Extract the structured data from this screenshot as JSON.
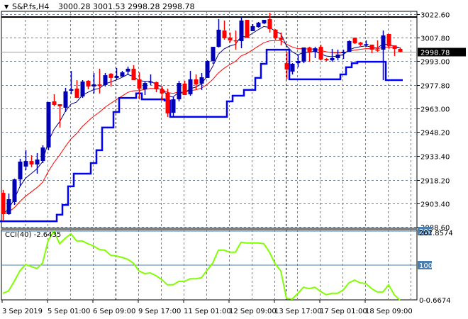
{
  "chart_data": {
    "type": "candlestick",
    "symbol_header": "S&P.fs,H4",
    "ohlc_header": "3000.28 3001.53 2998.28 2998.78",
    "current_price": 2998.78,
    "current_price_label": "2998.78",
    "resistance_level": 3020.8,
    "ylim": [
      2888.6,
      3024.4
    ],
    "price_ticks": [
      "3022.60",
      "3007.80",
      "2993.00",
      "2977.80",
      "2963.00",
      "2948.20",
      "2933.40",
      "2918.20",
      "2903.40",
      "2888.60"
    ],
    "price_tick_values": [
      3022.6,
      3007.8,
      2993.0,
      2977.8,
      2963.0,
      2948.2,
      2933.4,
      2918.2,
      2903.4,
      2888.6
    ],
    "time_labels": [
      "3 Sep 2019",
      "5 Sep 01:00",
      "6 Sep 09:00",
      "9 Sep 17:00",
      "11 Sep 01:00",
      "12 Sep 09:00",
      "13 Sep 17:00",
      "17 Sep 01:00",
      "18 Sep 09:00"
    ],
    "time_label_bar_index": [
      0,
      8,
      16,
      24,
      32,
      40,
      48,
      56,
      64
    ],
    "separator_bar_index": [
      20,
      50
    ],
    "candles": [
      [
        2909.9,
        2911.7,
        2892.0,
        2896.5
      ],
      [
        2896.5,
        2909.5,
        2896.1,
        2905.9
      ],
      [
        2904.1,
        2918.9,
        2902.3,
        2918.4
      ],
      [
        2918.4,
        2931.4,
        2914.0,
        2929.6
      ],
      [
        2926.5,
        2936.8,
        2924.2,
        2930.0
      ],
      [
        2930.0,
        2933.6,
        2926.1,
        2927.8
      ],
      [
        2927.8,
        2935.0,
        2922.0,
        2930.9
      ],
      [
        2930.0,
        2939.9,
        2928.7,
        2938.5
      ],
      [
        2938.5,
        2967.2,
        2936.8,
        2967.2
      ],
      [
        2967.6,
        2972.1,
        2964.5,
        2965.4
      ],
      [
        2965.8,
        2965.8,
        2951.1,
        2964.5
      ],
      [
        2963.6,
        2976.1,
        2960.9,
        2973.9
      ],
      [
        2974.3,
        2986.8,
        2972.1,
        2975.2
      ],
      [
        2975.7,
        2981.0,
        2969.8,
        2969.8
      ],
      [
        2970.7,
        2981.0,
        2969.8,
        2980.1
      ],
      [
        2980.6,
        2981.0,
        2975.2,
        2977.0
      ],
      [
        2977.0,
        2985.5,
        2972.6,
        2978.3
      ],
      [
        2978.3,
        2988.2,
        2972.6,
        2977.4
      ],
      [
        2977.9,
        2985.5,
        2977.0,
        2984.1
      ],
      [
        2985.0,
        2985.5,
        2977.0,
        2982.4
      ],
      [
        2982.4,
        2988.6,
        2981.5,
        2983.7
      ],
      [
        2983.2,
        2986.8,
        2983.2,
        2985.9
      ],
      [
        2986.4,
        2989.5,
        2984.6,
        2988.2
      ],
      [
        2988.2,
        2990.4,
        2981.0,
        2981.0
      ],
      [
        2981.5,
        2985.9,
        2968.9,
        2975.7
      ],
      [
        2975.2,
        2980.1,
        2971.6,
        2979.2
      ],
      [
        2979.7,
        2984.6,
        2977.9,
        2980.1
      ],
      [
        2979.7,
        2980.1,
        2973.4,
        2975.2
      ],
      [
        2975.2,
        2977.4,
        2968.1,
        2972.6
      ],
      [
        2973.0,
        2975.7,
        2957.8,
        2960.0
      ],
      [
        2960.4,
        2970.3,
        2957.8,
        2968.9
      ],
      [
        2968.9,
        2980.6,
        2967.6,
        2979.2
      ],
      [
        2978.8,
        2980.6,
        2971.6,
        2971.6
      ],
      [
        2972.1,
        2986.8,
        2971.2,
        2981.5
      ],
      [
        2981.5,
        2984.6,
        2975.2,
        2978.3
      ],
      [
        2978.8,
        2985.5,
        2974.8,
        2982.8
      ],
      [
        2982.4,
        2993.5,
        2982.4,
        2993.1
      ],
      [
        2993.1,
        3002.0,
        2991.3,
        3002.0
      ],
      [
        3002.0,
        3019.5,
        3001.6,
        3012.8
      ],
      [
        3012.3,
        3018.6,
        3006.5,
        3007.4
      ],
      [
        3007.8,
        3011.0,
        3004.7,
        3006.1
      ],
      [
        3006.1,
        3012.3,
        3000.2,
        3005.6
      ],
      [
        3005.6,
        3021.3,
        3001.1,
        3018.6
      ],
      [
        3019.0,
        3019.0,
        3007.4,
        3007.8
      ],
      [
        3011.9,
        3016.3,
        3011.9,
        3015.0
      ],
      [
        3014.5,
        3017.7,
        3014.1,
        3017.2
      ],
      [
        3016.8,
        3019.0,
        3016.3,
        3019.0
      ],
      [
        3019.5,
        3023.5,
        3011.0,
        3013.2
      ],
      [
        3012.8,
        3013.2,
        3006.5,
        3007.4
      ],
      [
        3007.8,
        3011.0,
        3002.9,
        3006.5
      ],
      [
        2991.7,
        2998.9,
        2981.5,
        2987.7
      ],
      [
        2986.4,
        2991.7,
        2984.6,
        2991.3
      ],
      [
        2991.7,
        2996.7,
        2989.1,
        2993.1
      ],
      [
        2992.6,
        3001.6,
        2991.7,
        3001.6
      ],
      [
        3001.6,
        3002.0,
        2992.6,
        2998.5
      ],
      [
        2998.9,
        3002.0,
        2994.9,
        3001.1
      ],
      [
        3002.0,
        3003.4,
        2993.5,
        2994.0
      ],
      [
        2994.4,
        2994.9,
        2993.1,
        2993.5
      ],
      [
        2993.5,
        3000.7,
        2992.6,
        2994.9
      ],
      [
        2994.9,
        3000.2,
        2993.5,
        2997.1
      ],
      [
        2998.0,
        3000.2,
        2994.4,
        2998.9
      ],
      [
        2998.9,
        3006.1,
        2998.9,
        3005.6
      ],
      [
        3007.8,
        3007.8,
        3003.8,
        3004.3
      ],
      [
        3004.7,
        3005.2,
        3002.5,
        3003.4
      ],
      [
        3003.4,
        3006.1,
        3002.0,
        3003.8
      ],
      [
        3003.4,
        3003.4,
        2998.0,
        3000.2
      ],
      [
        3000.2,
        3006.1,
        2998.9,
        2999.8
      ],
      [
        3000.2,
        3012.3,
        2981.0,
        3009.2
      ],
      [
        3010.1,
        3010.1,
        3000.7,
        3002.5
      ],
      [
        3002.9,
        3002.9,
        2996.2,
        3000.7
      ],
      [
        3000.7,
        3001.6,
        2998.5,
        2998.78
      ]
    ],
    "cci": {
      "label": "CCI(40) -2.6435",
      "ylim": [
        -6.67,
        207.86
      ],
      "levels": [
        100,
        200
      ],
      "axis_labels": {
        "top_level": "200",
        "top": "207.8574",
        "mid": "100",
        "bottom_level": "0",
        "bottom": "-0.6674"
      },
      "values": [
        17,
        24,
        52,
        83,
        102,
        96,
        90,
        106,
        173,
        200,
        163,
        179,
        192,
        171,
        171,
        163,
        156,
        146,
        144,
        129,
        127,
        123,
        117,
        106,
        83,
        75,
        77,
        69,
        58,
        42,
        42,
        52,
        52,
        60,
        60,
        63,
        85,
        106,
        144,
        144,
        138,
        138,
        167,
        165,
        165,
        165,
        163,
        138,
        104,
        83,
        2,
        0,
        17,
        35,
        31,
        35,
        23,
        13,
        17,
        17,
        27,
        48,
        56,
        48,
        46,
        31,
        21,
        21,
        42,
        13,
        -3
      ]
    },
    "colors": {
      "bull": "#0000b0",
      "bear": "#ff0000",
      "fast_ma": "#000080",
      "slow_ma": "#ff0000",
      "stop_line": "#0000ff",
      "cci": "#80ff00",
      "level": "#4a7fb0"
    }
  }
}
